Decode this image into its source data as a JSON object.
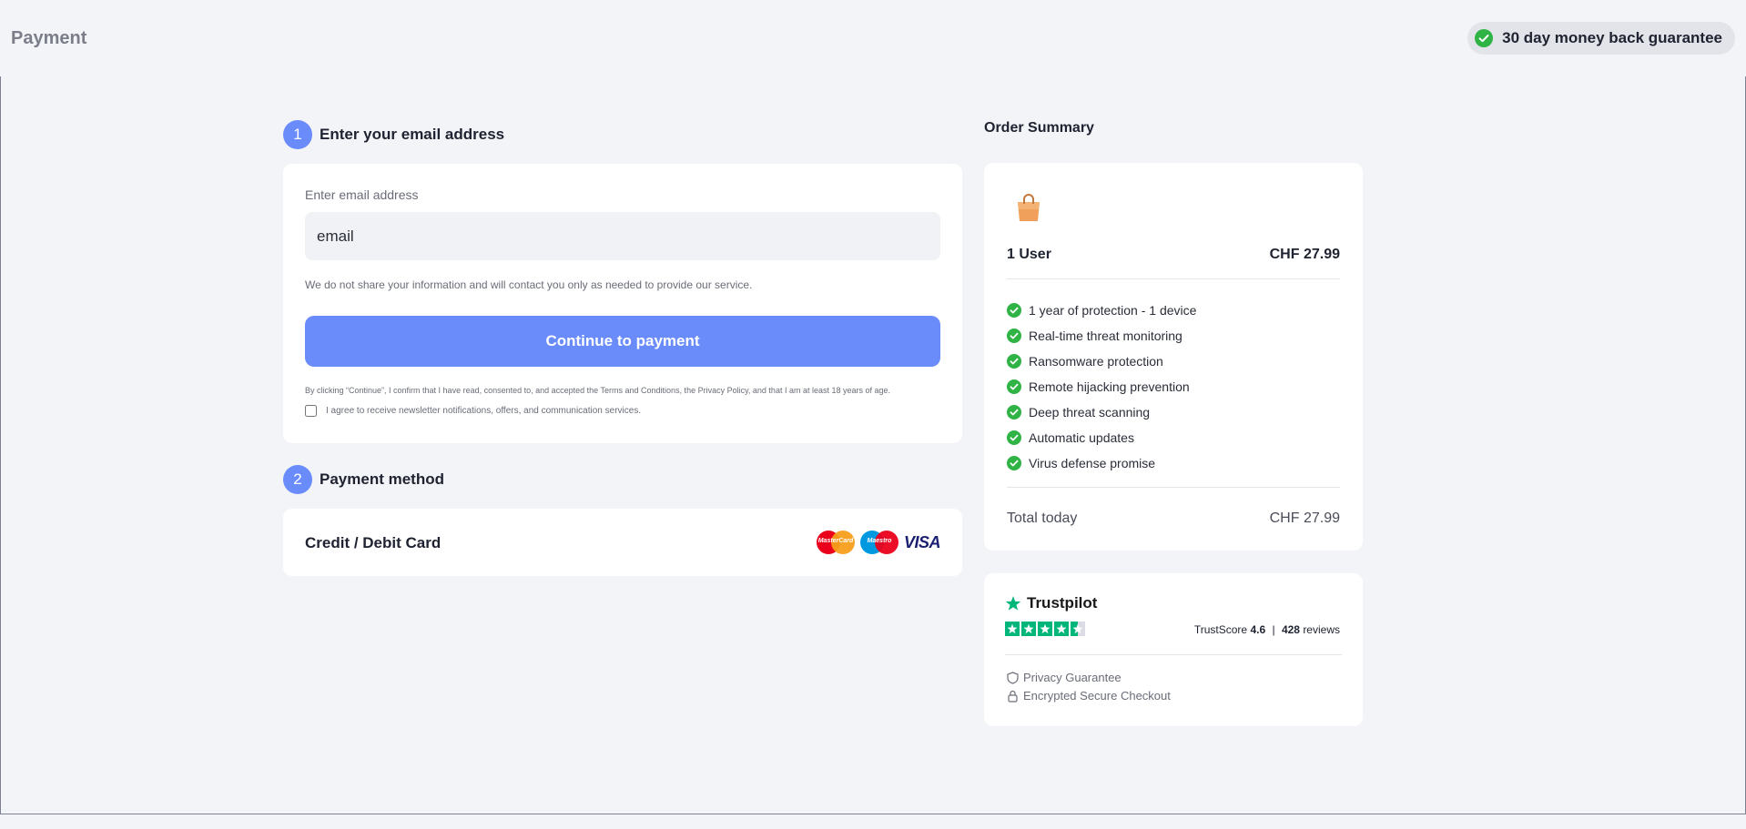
{
  "header": {
    "title": "Payment",
    "guarantee": "30 day money back guarantee"
  },
  "step1": {
    "number": "1",
    "title": "Enter your email address",
    "email_label": "Enter email address",
    "email_placeholder": "email",
    "privacy_note": "We do not share your information and will contact you only as needed to provide our service.",
    "continue_label": "Continue to payment",
    "terms": "By clicking “Continue”, I confirm that I have read, consented to, and accepted the Terms and Conditions, the Privacy Policy, and that I am at least 18 years of age.",
    "newsletter_label": "I agree to receive newsletter notifications, offers, and communication services.",
    "newsletter_checked": false
  },
  "step2": {
    "number": "2",
    "title": "Payment method",
    "method_label": "Credit / Debit Card",
    "card_logos": [
      "MasterCard",
      "Maestro",
      "VISA"
    ]
  },
  "summary": {
    "title": "Order Summary",
    "icon": "shopping-bag-icon",
    "plan": "1 User",
    "price": "CHF 27.99",
    "features": [
      "1 year of protection - 1 device",
      "Real-time threat monitoring",
      "Ransomware protection",
      "Remote hijacking prevention",
      "Deep threat scanning",
      "Automatic updates",
      "Virus defense promise"
    ],
    "total_label": "Total today",
    "total_value": "CHF 27.99"
  },
  "trust": {
    "brand": "Trustpilot",
    "stars": 4.5,
    "score_label": "TrustScore",
    "score": "4.6",
    "reviews_count": "428",
    "reviews_label": "reviews",
    "privacy": "Privacy Guarantee",
    "secure": "Encrypted Secure Checkout"
  },
  "colors": {
    "accent": "#6a8cfb",
    "success": "#2fb344",
    "trustpilot": "#00b67a",
    "background": "#f3f4f8"
  }
}
